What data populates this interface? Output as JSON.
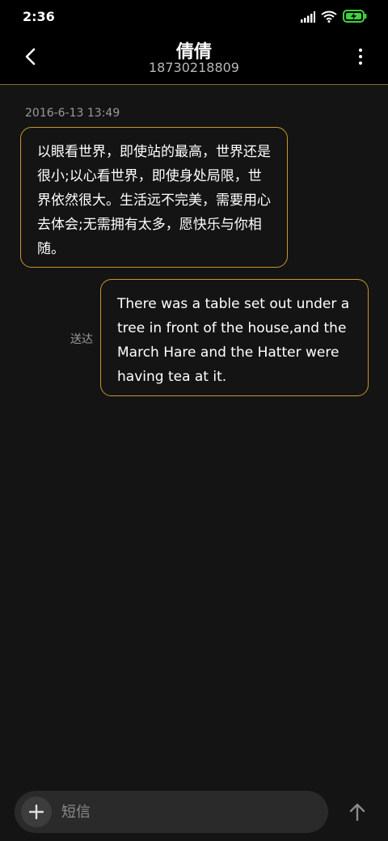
{
  "status_bar": {
    "time": "2:36",
    "icons": [
      "signal-icon",
      "wifi-icon",
      "battery-charging-icon"
    ],
    "battery_color": "#3fd13f"
  },
  "header": {
    "back_icon": "chevron-left-icon",
    "contact_name": "倩倩",
    "contact_number": "18730218809",
    "more_icon": "more-vertical-icon"
  },
  "conversation": {
    "timestamp": "2016-6-13 13:49",
    "received_message": "以眼看世界，即使站的最高，世界还是很小;以心看世界，即使身处局限，世界依然很大。生活远不完美，需要用心去体会;无需拥有太多，愿快乐与你相随。",
    "sent_message": "There was a table set out under a tree in front of the house,and the March Hare and the Hatter were having tea at it.",
    "sent_status": "送达"
  },
  "composer": {
    "add_icon": "plus-icon",
    "placeholder": "短信",
    "send_icon": "arrow-up-icon"
  },
  "colors": {
    "accent": "#c8952e",
    "background": "#141414",
    "bar_background": "#000000"
  }
}
